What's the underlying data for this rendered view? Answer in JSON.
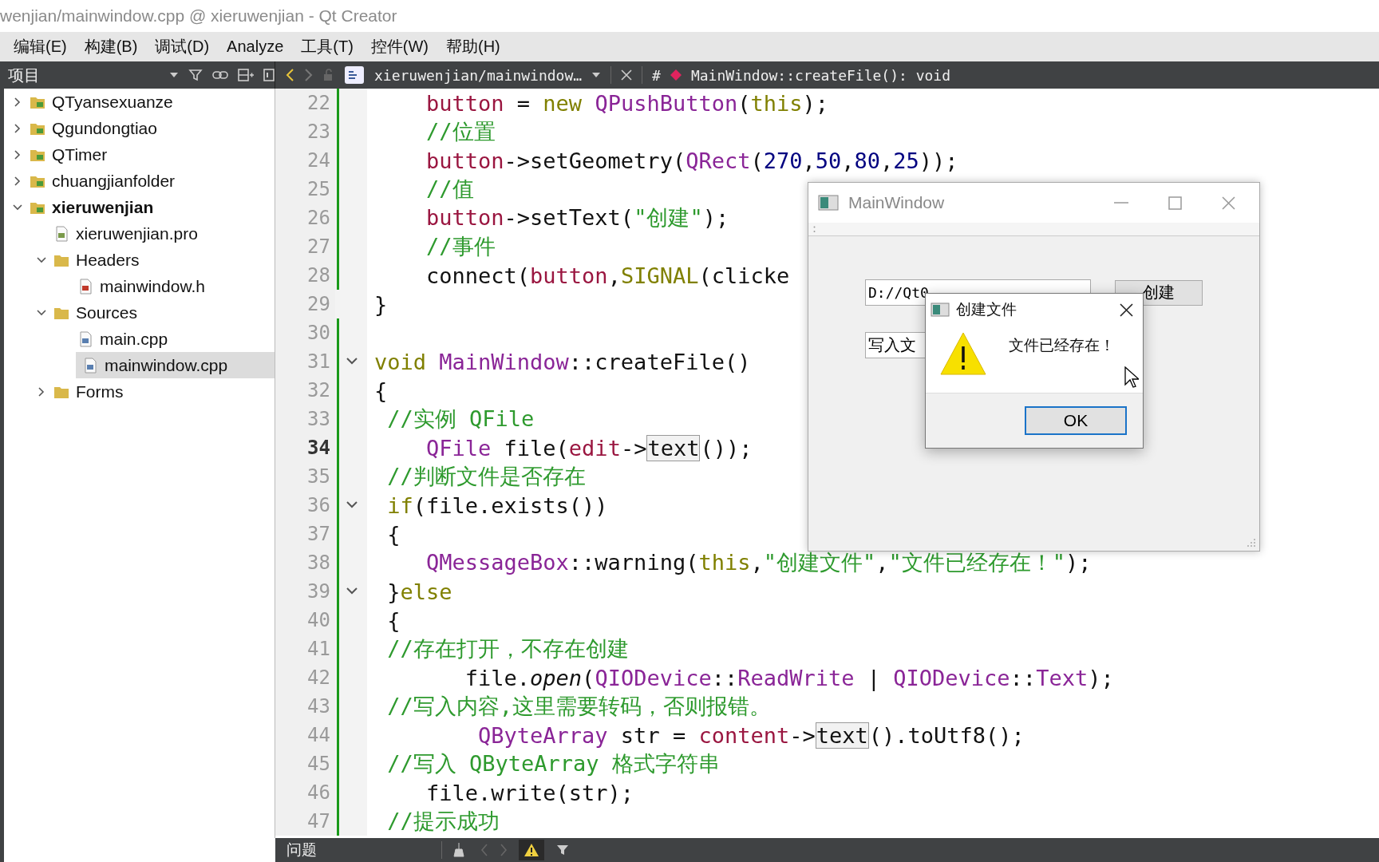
{
  "window": {
    "title": "wenjian/mainwindow.cpp @ xieruwenjian - Qt Creator"
  },
  "menu": [
    "编辑(E)",
    "构建(B)",
    "调试(D)",
    "Analyze",
    "工具(T)",
    "控件(W)",
    "帮助(H)"
  ],
  "sidebar": {
    "title": "项目",
    "items": [
      {
        "label": "QTyansexuanze",
        "kind": "project",
        "expanded": false,
        "active": false,
        "selected": false
      },
      {
        "label": "Qgundongtiao",
        "kind": "project",
        "expanded": false,
        "active": false,
        "selected": false
      },
      {
        "label": "QTimer",
        "kind": "project",
        "expanded": false,
        "active": false,
        "selected": false
      },
      {
        "label": "chuangjianfolder",
        "kind": "project",
        "expanded": false,
        "active": false,
        "selected": false
      },
      {
        "label": "xieruwenjian",
        "kind": "project",
        "expanded": true,
        "active": true,
        "selected": false,
        "children": [
          {
            "label": "xieruwenjian.pro",
            "kind": "pro",
            "selected": false
          },
          {
            "label": "Headers",
            "kind": "headers",
            "expanded": true,
            "selected": false,
            "children": [
              {
                "label": "mainwindow.h",
                "kind": "h",
                "selected": false
              }
            ]
          },
          {
            "label": "Sources",
            "kind": "sources",
            "expanded": true,
            "selected": false,
            "children": [
              {
                "label": "main.cpp",
                "kind": "cpp",
                "selected": false
              },
              {
                "label": "mainwindow.cpp",
                "kind": "cpp",
                "selected": true
              }
            ]
          },
          {
            "label": "Forms",
            "kind": "forms",
            "expanded": false,
            "selected": false
          }
        ]
      }
    ]
  },
  "editor_bar": {
    "file": "xieruwenjian/mainwindow…",
    "hash": "#",
    "symbol": "MainWindow::createFile(): void"
  },
  "code": [
    {
      "n": "22",
      "current": false,
      "changed": true,
      "fold": false,
      "tokens": [
        {
          "t": "    button",
          "kind": "var"
        },
        {
          "t": " = "
        },
        {
          "t": "new ",
          "kind": "kw"
        },
        {
          "t": "QPushButton",
          "kind": "type"
        },
        {
          "t": "("
        },
        {
          "t": "this",
          "kind": "kw"
        },
        {
          "t": ");"
        }
      ]
    },
    {
      "n": "23",
      "current": false,
      "changed": true,
      "fold": false,
      "tokens": [
        {
          "t": "    //位置",
          "kind": "comment"
        }
      ]
    },
    {
      "n": "24",
      "current": false,
      "changed": true,
      "fold": false,
      "tokens": [
        {
          "t": "    button",
          "kind": "var"
        },
        {
          "t": "->setGeometry("
        },
        {
          "t": "QRect",
          "kind": "type"
        },
        {
          "t": "("
        },
        {
          "t": "270",
          "kind": "num"
        },
        {
          "t": ","
        },
        {
          "t": "50",
          "kind": "num"
        },
        {
          "t": ","
        },
        {
          "t": "80",
          "kind": "num"
        },
        {
          "t": ","
        },
        {
          "t": "25",
          "kind": "num"
        },
        {
          "t": "));"
        }
      ]
    },
    {
      "n": "25",
      "current": false,
      "changed": true,
      "fold": false,
      "tokens": [
        {
          "t": "    //值",
          "kind": "comment"
        }
      ]
    },
    {
      "n": "26",
      "current": false,
      "changed": true,
      "fold": false,
      "tokens": [
        {
          "t": "    button",
          "kind": "var"
        },
        {
          "t": "->setText("
        },
        {
          "t": "\"创建\"",
          "kind": "str"
        },
        {
          "t": ");"
        }
      ]
    },
    {
      "n": "27",
      "current": false,
      "changed": true,
      "fold": false,
      "tokens": [
        {
          "t": "    //事件",
          "kind": "comment"
        }
      ]
    },
    {
      "n": "28",
      "current": false,
      "changed": true,
      "fold": false,
      "tokens": [
        {
          "t": "    connect("
        },
        {
          "t": "button",
          "kind": "var"
        },
        {
          "t": ","
        },
        {
          "t": "SIGNAL",
          "kind": "kw"
        },
        {
          "t": "(clicke"
        }
      ]
    },
    {
      "n": "29",
      "current": false,
      "changed": false,
      "fold": false,
      "tokens": [
        {
          "t": "}"
        }
      ]
    },
    {
      "n": "30",
      "current": false,
      "changed": true,
      "fold": false
    },
    {
      "n": "31",
      "current": false,
      "changed": true,
      "fold": true,
      "tokens": [
        {
          "t": "void ",
          "kind": "kw"
        },
        {
          "t": "MainWindow",
          "kind": "type"
        },
        {
          "t": "::createFile()"
        }
      ]
    },
    {
      "n": "32",
      "current": false,
      "changed": true,
      "fold": false,
      "tokens": [
        {
          "t": "{"
        }
      ]
    },
    {
      "n": "33",
      "current": false,
      "changed": true,
      "fold": false,
      "tokens": [
        {
          "t": " //实例 QFile",
          "kind": "comment"
        }
      ]
    },
    {
      "n": "34",
      "current": true,
      "changed": true,
      "fold": false,
      "tokens": [
        {
          "t": "    QFile",
          "kind": "type"
        },
        {
          "t": " file("
        },
        {
          "t": "edit",
          "kind": "var"
        },
        {
          "t": "->"
        },
        {
          "t": "text",
          "kind": "match"
        },
        {
          "t": "());"
        }
      ]
    },
    {
      "n": "35",
      "current": false,
      "changed": true,
      "fold": false,
      "tokens": [
        {
          "t": " //判断文件是否存在",
          "kind": "comment"
        }
      ]
    },
    {
      "n": "36",
      "current": false,
      "changed": true,
      "fold": true,
      "tokens": [
        {
          "t": " if",
          "kind": "kw"
        },
        {
          "t": "(file.exists())"
        }
      ]
    },
    {
      "n": "37",
      "current": false,
      "changed": true,
      "fold": false,
      "tokens": [
        {
          "t": " {"
        }
      ]
    },
    {
      "n": "38",
      "current": false,
      "changed": true,
      "fold": false,
      "tokens": [
        {
          "t": "    QMessageBox",
          "kind": "type"
        },
        {
          "t": "::warning("
        },
        {
          "t": "this",
          "kind": "kw"
        },
        {
          "t": ","
        },
        {
          "t": "\"创建文件\"",
          "kind": "str"
        },
        {
          "t": ","
        },
        {
          "t": "\"文件已经存在！\"",
          "kind": "str"
        },
        {
          "t": ");"
        }
      ]
    },
    {
      "n": "39",
      "current": false,
      "changed": true,
      "fold": true,
      "tokens": [
        {
          "t": " }"
        },
        {
          "t": "else",
          "kind": "kw"
        }
      ]
    },
    {
      "n": "40",
      "current": false,
      "changed": true,
      "fold": false,
      "tokens": [
        {
          "t": " {"
        }
      ]
    },
    {
      "n": "41",
      "current": false,
      "changed": true,
      "fold": false,
      "tokens": [
        {
          "t": " //存在打开，不存在创建",
          "kind": "comment"
        }
      ]
    },
    {
      "n": "42",
      "current": false,
      "changed": true,
      "fold": false,
      "tokens": [
        {
          "t": "       file."
        },
        {
          "t": "open",
          "kind": "italic"
        },
        {
          "t": "("
        },
        {
          "t": "QIODevice",
          "kind": "type"
        },
        {
          "t": "::"
        },
        {
          "t": "ReadWrite",
          "kind": "type"
        },
        {
          "t": " | "
        },
        {
          "t": "QIODevice",
          "kind": "type"
        },
        {
          "t": "::"
        },
        {
          "t": "Text",
          "kind": "type"
        },
        {
          "t": ");"
        }
      ]
    },
    {
      "n": "43",
      "current": false,
      "changed": true,
      "fold": false,
      "tokens": [
        {
          "t": " //写入内容,这里需要转码，否则报错。",
          "kind": "comment"
        }
      ]
    },
    {
      "n": "44",
      "current": false,
      "changed": true,
      "fold": false,
      "tokens": [
        {
          "t": "        QByteArray",
          "kind": "type"
        },
        {
          "t": " str = "
        },
        {
          "t": "content",
          "kind": "var"
        },
        {
          "t": "->"
        },
        {
          "t": "text",
          "kind": "match"
        },
        {
          "t": "().toUtf8();"
        }
      ]
    },
    {
      "n": "45",
      "current": false,
      "changed": true,
      "fold": false,
      "tokens": [
        {
          "t": " //写入 QByteArray 格式字符串",
          "kind": "comment"
        }
      ]
    },
    {
      "n": "46",
      "current": false,
      "changed": true,
      "fold": false,
      "tokens": [
        {
          "t": "    file.write(str);"
        }
      ]
    },
    {
      "n": "47",
      "current": false,
      "changed": true,
      "fold": false,
      "tokens": [
        {
          "t": " //提示成功",
          "kind": "comment"
        }
      ]
    }
  ],
  "app_window": {
    "title": "MainWindow",
    "path_field": "D://Qt0",
    "content_field": "写入文",
    "create_button": "创建"
  },
  "dialog": {
    "title": "创建文件",
    "message": "文件已经存在！",
    "ok_button": "OK"
  },
  "output_bar": {
    "title": "问题",
    "warnings_on": true
  }
}
